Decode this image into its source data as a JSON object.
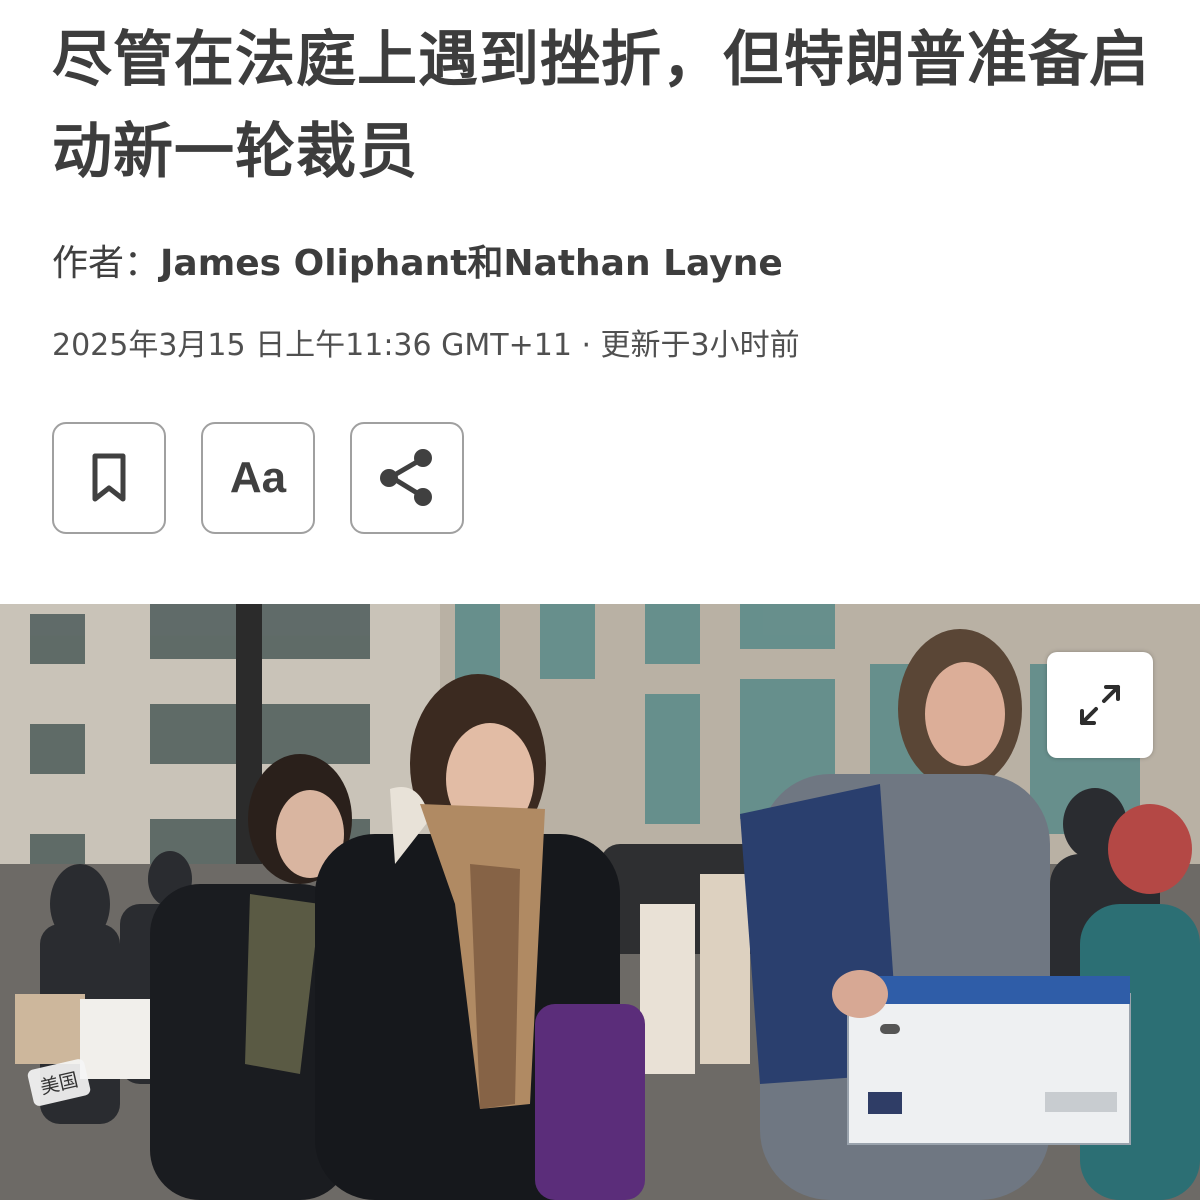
{
  "article": {
    "headline": "尽管在法庭上遇到挫折，但特朗普准备启动新一轮裁员",
    "byline_prefix": "作者：",
    "authors": "James Oliphant和Nathan Layne",
    "dateline": "2025年3月15 日上午11:36 GMT+11 · 更新于3小时前"
  },
  "toolbar": {
    "bookmark_icon": "bookmark-icon",
    "font_size_label": "Aa",
    "share_icon": "share-icon"
  },
  "photo": {
    "expand_icon": "expand-icon",
    "location_tag": "美国"
  },
  "colors": {
    "text": "#3d3d3d",
    "button_border": "#a0a0a0",
    "background": "#ffffff"
  }
}
